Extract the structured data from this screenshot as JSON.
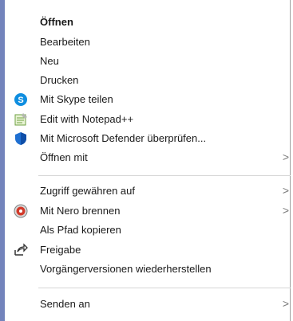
{
  "menu": {
    "items": [
      {
        "label": "Öffnen",
        "icon": "",
        "submenu": false
      },
      {
        "label": "Bearbeiten",
        "icon": "",
        "submenu": false
      },
      {
        "label": "Neu",
        "icon": "",
        "submenu": false
      },
      {
        "label": "Drucken",
        "icon": "",
        "submenu": false
      },
      {
        "label": "Mit Skype teilen",
        "icon": "skype-icon",
        "submenu": false
      },
      {
        "label": "Edit with Notepad++",
        "icon": "notepad-plus-plus-icon",
        "submenu": false
      },
      {
        "label": "Mit Microsoft Defender überprüfen...",
        "icon": "defender-shield-icon",
        "submenu": false
      },
      {
        "label": "Öffnen mit",
        "icon": "",
        "submenu": true
      },
      {
        "label": "Zugriff gewähren auf",
        "icon": "",
        "submenu": true
      },
      {
        "label": "Mit Nero brennen",
        "icon": "nero-icon",
        "submenu": true
      },
      {
        "label": "Als Pfad kopieren",
        "icon": "",
        "submenu": false
      },
      {
        "label": "Freigabe",
        "icon": "share-icon",
        "submenu": false
      },
      {
        "label": "Vorgängerversionen wiederherstellen",
        "icon": "",
        "submenu": false
      },
      {
        "label": "Senden an",
        "icon": "",
        "submenu": true
      }
    ],
    "submenu_arrow": ">",
    "colors": {
      "skype": "#0f8ee0",
      "defender": "#1f6fd1",
      "left_edge": "#5b6fb0"
    }
  }
}
